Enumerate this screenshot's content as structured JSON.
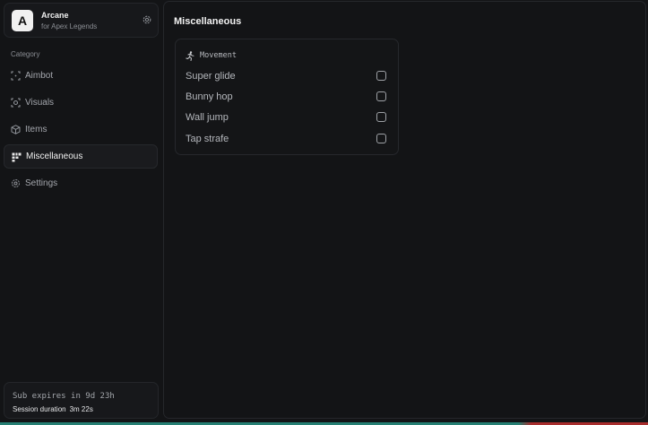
{
  "brand": {
    "logo_letter": "A",
    "name": "Arcane",
    "subtitle": "for Apex Legends"
  },
  "sidebar": {
    "category_label": "Category",
    "items": [
      {
        "label": "Aimbot",
        "icon": "crosshair-icon",
        "active": false
      },
      {
        "label": "Visuals",
        "icon": "scan-icon",
        "active": false
      },
      {
        "label": "Items",
        "icon": "box-icon",
        "active": false
      },
      {
        "label": "Miscellaneous",
        "icon": "grid-icon",
        "active": true
      },
      {
        "label": "Settings",
        "icon": "gear-icon",
        "active": false
      }
    ]
  },
  "status": {
    "expires_text": "Sub expires in 9d 23h",
    "session_label": "Session duration",
    "session_value": "3m 22s"
  },
  "main": {
    "title": "Miscellaneous",
    "card": {
      "title": "Movement",
      "icon": "running-icon",
      "options": [
        {
          "label": "Super glide",
          "checked": false
        },
        {
          "label": "Bunny hop",
          "checked": false
        },
        {
          "label": "Wall jump",
          "checked": false
        },
        {
          "label": "Tap strafe",
          "checked": false
        }
      ]
    }
  },
  "colors": {
    "background": "#131416",
    "panel_border": "#25272b",
    "text_primary": "#f0f0f0",
    "text_muted": "#8b8e94"
  }
}
